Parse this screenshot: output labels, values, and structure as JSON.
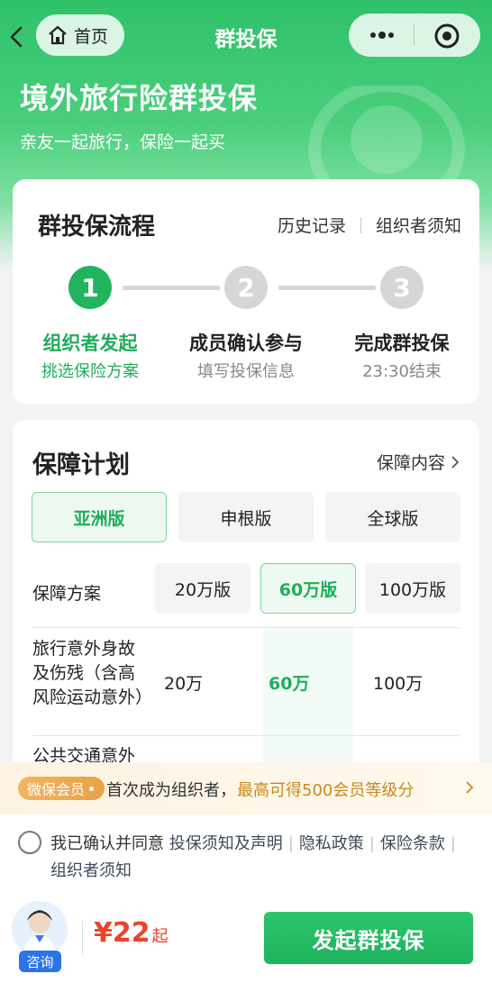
{
  "nav": {
    "home_label": "首页",
    "title": "群投保"
  },
  "hero": {
    "title": "境外旅行险群投保",
    "subtitle": "亲友一起旅行，保险一起买"
  },
  "process": {
    "title": "群投保流程",
    "link_history": "历史记录",
    "link_notice": "组织者须知",
    "steps": [
      {
        "num": "1",
        "title": "组织者发起",
        "sub": "挑选保险方案",
        "active": true
      },
      {
        "num": "2",
        "title": "成员确认参与",
        "sub": "填写投保信息",
        "active": false
      },
      {
        "num": "3",
        "title": "完成群投保",
        "sub": "23:30结束",
        "active": false
      }
    ]
  },
  "plan": {
    "title": "保障计划",
    "link": "保障内容",
    "versions": [
      "亚洲版",
      "申根版",
      "全球版"
    ],
    "selected_version": "亚洲版",
    "scheme_label": "保障方案",
    "amounts": [
      "20万版",
      "60万版",
      "100万版"
    ],
    "selected_amount": "60万版",
    "rows": [
      {
        "label": "旅行意外身故及伤残（含高风险运动意外）",
        "values": [
          "20万",
          "60万",
          "100万"
        ]
      },
      {
        "label": "公共交通意外"
      }
    ]
  },
  "banner": {
    "badge": "微保会员",
    "text": "首次成为组织者，",
    "highlight": "最高可得500会员等级分"
  },
  "agreement": {
    "prefix": "我已确认并同意",
    "links": [
      "投保须知及声明",
      "隐私政策",
      "保险条款",
      "组织者须知"
    ]
  },
  "footer": {
    "consult_label": "咨询",
    "currency": "¥",
    "price": "22",
    "price_suffix": "起",
    "cta_label": "发起群投保"
  },
  "colors": {
    "primary": "#22b35e",
    "accent_price": "#e9452c",
    "banner_highlight": "#c78a1e"
  }
}
